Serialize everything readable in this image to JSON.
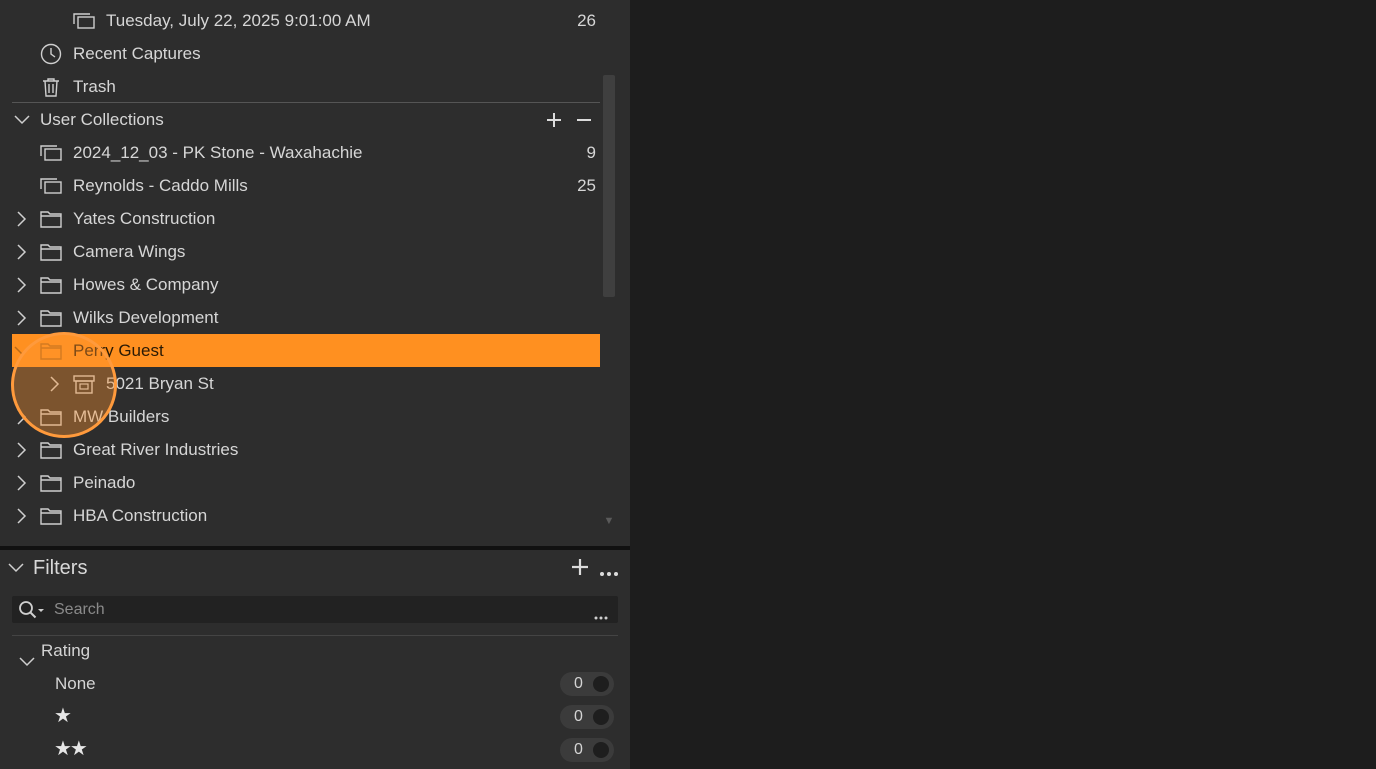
{
  "tree": {
    "top_rows": [
      {
        "label": "Tuesday, July 22, 2025 9:01:00 AM",
        "count": "26",
        "icon": "album-icon"
      },
      {
        "label": "Recent Captures",
        "icon": "clock-icon"
      },
      {
        "label": "Trash",
        "icon": "trash-icon"
      }
    ],
    "user_collections": {
      "label": "User Collections",
      "items": [
        {
          "label": "2024_12_03 - PK Stone - Waxahachie",
          "count": "9",
          "icon": "album-icon"
        },
        {
          "label": "Reynolds - Caddo Mills",
          "count": "25",
          "icon": "album-icon"
        },
        {
          "label": "Yates Construction",
          "icon": "folder-icon"
        },
        {
          "label": "Camera Wings",
          "icon": "folder-icon"
        },
        {
          "label": "Howes & Company",
          "icon": "folder-icon"
        },
        {
          "label": "Wilks Development",
          "icon": "folder-icon"
        },
        {
          "label": "Perry Guest",
          "icon": "folder-icon",
          "selected": true
        },
        {
          "label": "5021 Bryan St",
          "icon": "project-icon"
        },
        {
          "label": "MW Builders",
          "icon": "folder-icon"
        },
        {
          "label": "Great River Industries",
          "icon": "folder-icon"
        },
        {
          "label": "Peinado",
          "icon": "folder-icon"
        },
        {
          "label": "HBA Construction",
          "icon": "folder-icon"
        }
      ]
    }
  },
  "filters": {
    "title": "Filters",
    "search_placeholder": "Search",
    "rating": {
      "label": "Rating",
      "rows": [
        {
          "label": "None",
          "count": "0"
        },
        {
          "label": "★",
          "count": "0"
        },
        {
          "label": "★★",
          "count": "0"
        }
      ]
    }
  },
  "colors": {
    "selection": "#ff9020",
    "panel": "#2d2d2d",
    "background": "#1d1d1d"
  }
}
